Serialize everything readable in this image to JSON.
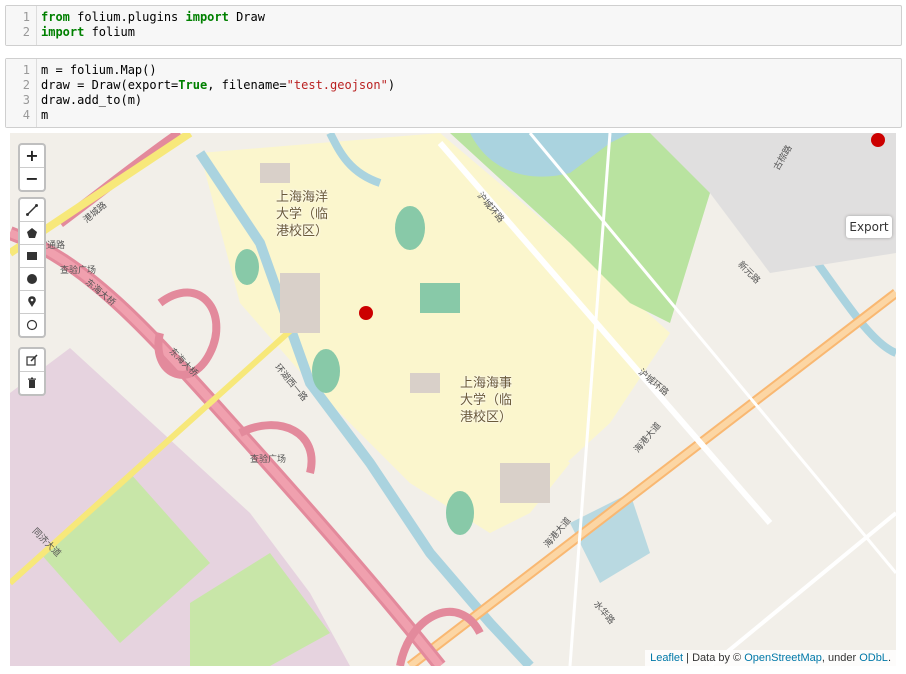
{
  "cell1": {
    "lines": [
      {
        "num": "1",
        "parts": [
          {
            "t": "from",
            "k": "kw"
          },
          {
            "t": " folium.plugins ",
            "k": ""
          },
          {
            "t": "import",
            "k": "kw"
          },
          {
            "t": " Draw",
            "k": ""
          }
        ]
      },
      {
        "num": "2",
        "parts": [
          {
            "t": "import",
            "k": "kw"
          },
          {
            "t": " folium",
            "k": ""
          }
        ]
      }
    ]
  },
  "cell2": {
    "lines": [
      {
        "num": "1",
        "parts": [
          {
            "t": "m = folium.Map()",
            "k": ""
          }
        ]
      },
      {
        "num": "2",
        "parts": [
          {
            "t": "draw = Draw(export=",
            "k": ""
          },
          {
            "t": "True",
            "k": "kw"
          },
          {
            "t": ", filename=",
            "k": ""
          },
          {
            "t": "\"test.geojson\"",
            "k": "str"
          },
          {
            "t": ")",
            "k": ""
          }
        ]
      },
      {
        "num": "3",
        "parts": [
          {
            "t": "draw.add_to(m)",
            "k": ""
          }
        ]
      },
      {
        "num": "4",
        "parts": [
          {
            "t": "m",
            "k": ""
          }
        ]
      }
    ]
  },
  "map": {
    "zoom_in": "+",
    "zoom_out": "−",
    "draw_tools": [
      "polyline-icon",
      "polygon-icon",
      "rectangle-icon",
      "circle-icon",
      "marker-icon",
      "circlemarker-icon"
    ],
    "edit_tools": [
      "edit-icon",
      "trash-icon"
    ],
    "export_label": "Export",
    "labels": {
      "uni1": "上海海洋\n大学（临\n港校区）",
      "uni2": "上海海事\n大学（临\n港校区）",
      "plaza1": "查验广场",
      "plaza2": "查验广场",
      "road_donghai": "东海大桥",
      "road_donghai2": "东海大桥",
      "road_gangcheng": "港城路",
      "road_tongji": "同济大道",
      "road_huanhu": "环湖西一路",
      "road_hugang": "沪城环路",
      "road_hugang2": "沪城环路",
      "road_gucheng": "古棕路",
      "road_shuishang": "水华路",
      "road_haigang": "海港大道",
      "road_haigang2": "海港大道",
      "road_xinyuan": "新元路",
      "road_west": "谊通路"
    },
    "attribution": {
      "leaflet": "Leaflet",
      "sep": " | Data by © ",
      "osm": "OpenStreetMap",
      "under": ", under ",
      "odbl": "ODbL",
      "end": "."
    }
  }
}
